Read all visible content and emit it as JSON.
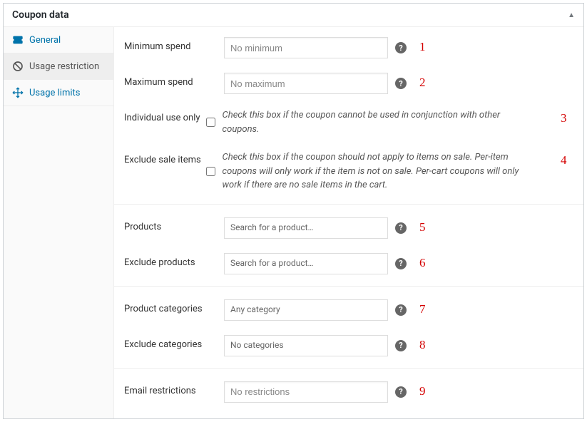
{
  "panel_title": "Coupon data",
  "tabs": {
    "general": "General",
    "usage_restriction": "Usage restriction",
    "usage_limits": "Usage limits"
  },
  "annotations": [
    "1",
    "2",
    "3",
    "4",
    "5",
    "6",
    "7",
    "8",
    "9"
  ],
  "fields": {
    "minimum_spend": {
      "label": "Minimum spend",
      "placeholder": "No minimum"
    },
    "maximum_spend": {
      "label": "Maximum spend",
      "placeholder": "No maximum"
    },
    "individual_use": {
      "label": "Individual use only",
      "desc": "Check this box if the coupon cannot be used in conjunction with other coupons."
    },
    "exclude_sale": {
      "label": "Exclude sale items",
      "desc": "Check this box if the coupon should not apply to items on sale. Per-item coupons will only work if the item is not on sale. Per-cart coupons will only work if there are no sale items in the cart."
    },
    "products": {
      "label": "Products",
      "placeholder": "Search for a product…"
    },
    "exclude_products": {
      "label": "Exclude products",
      "placeholder": "Search for a product…"
    },
    "product_categories": {
      "label": "Product categories",
      "placeholder": "Any category"
    },
    "exclude_categories": {
      "label": "Exclude categories",
      "placeholder": "No categories"
    },
    "email_restrictions": {
      "label": "Email restrictions",
      "placeholder": "No restrictions"
    }
  }
}
